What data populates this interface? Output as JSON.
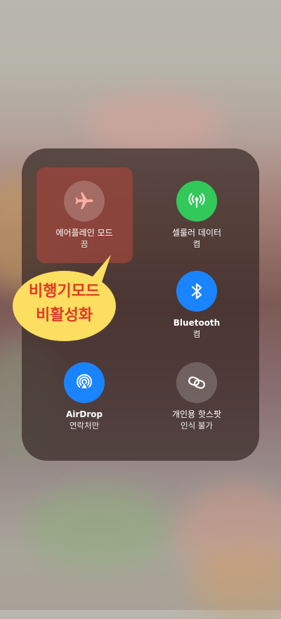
{
  "control_center": {
    "airplane": {
      "label": "에어플레인 모드",
      "status": "끔",
      "icon": "airplane-icon",
      "state": "off"
    },
    "cellular": {
      "label": "셀룰러 데이터",
      "status": "켬",
      "icon": "antenna-icon",
      "color": "#32c85a"
    },
    "bluetooth": {
      "label": "Bluetooth",
      "status": "켬",
      "icon": "bluetooth-icon",
      "color": "#1a84ff"
    },
    "airdrop": {
      "label": "AirDrop",
      "status": "연락처만",
      "icon": "airdrop-icon",
      "color": "#1a84ff"
    },
    "hotspot": {
      "label": "개인용 핫스팟",
      "status": "인식 불가",
      "icon": "hotspot-link-icon"
    }
  },
  "annotation": {
    "line1": "비행기모드",
    "line2": "비활성화",
    "bubble_color": "#fcde60",
    "text_color": "#e03a28"
  }
}
